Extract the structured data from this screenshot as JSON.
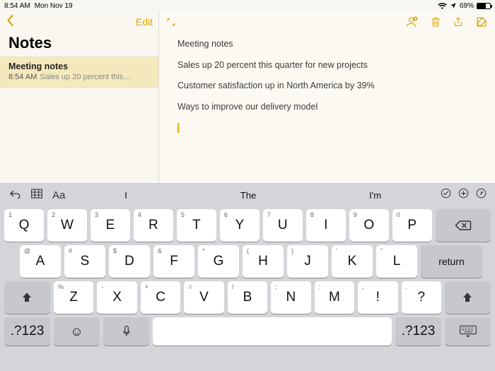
{
  "status": {
    "time": "8:54 AM",
    "date": "Mon Nov 19",
    "battery": "69%"
  },
  "sidebar": {
    "edit": "Edit",
    "title": "Notes",
    "items": [
      {
        "title": "Meeting notes",
        "time": "8:54 AM",
        "preview": "Sales up 20 percent this…"
      }
    ]
  },
  "note": {
    "lines": [
      "Meeting notes",
      "Sales up 20 percent this quarter for new projects",
      "Customer satisfaction up in North America by 39%",
      "Ways to improve our delivery model"
    ]
  },
  "suggestions": [
    "I",
    "The",
    "I'm"
  ],
  "keys": {
    "row1": [
      {
        "main": "Q",
        "sub": "1"
      },
      {
        "main": "W",
        "sub": "2"
      },
      {
        "main": "E",
        "sub": "3"
      },
      {
        "main": "R",
        "sub": "4"
      },
      {
        "main": "T",
        "sub": "5"
      },
      {
        "main": "Y",
        "sub": "6"
      },
      {
        "main": "U",
        "sub": "7"
      },
      {
        "main": "I",
        "sub": "8"
      },
      {
        "main": "O",
        "sub": "9"
      },
      {
        "main": "P",
        "sub": "0"
      }
    ],
    "row2": [
      {
        "main": "A",
        "sub": "@"
      },
      {
        "main": "S",
        "sub": "#"
      },
      {
        "main": "D",
        "sub": "$"
      },
      {
        "main": "F",
        "sub": "&"
      },
      {
        "main": "G",
        "sub": "*"
      },
      {
        "main": "H",
        "sub": "("
      },
      {
        "main": "J",
        "sub": ")"
      },
      {
        "main": "K",
        "sub": "'"
      },
      {
        "main": "L",
        "sub": "\""
      }
    ],
    "row3": [
      {
        "main": "Z",
        "sub": "%"
      },
      {
        "main": "X",
        "sub": "-"
      },
      {
        "main": "C",
        "sub": "+"
      },
      {
        "main": "V",
        "sub": "="
      },
      {
        "main": "B",
        "sub": "/"
      },
      {
        "main": "N",
        "sub": ";"
      },
      {
        "main": "M",
        "sub": ":"
      },
      {
        "main": "!",
        "sub": ","
      },
      {
        "main": "?",
        "sub": "."
      }
    ],
    "numkey": ".?123",
    "return": "return"
  }
}
